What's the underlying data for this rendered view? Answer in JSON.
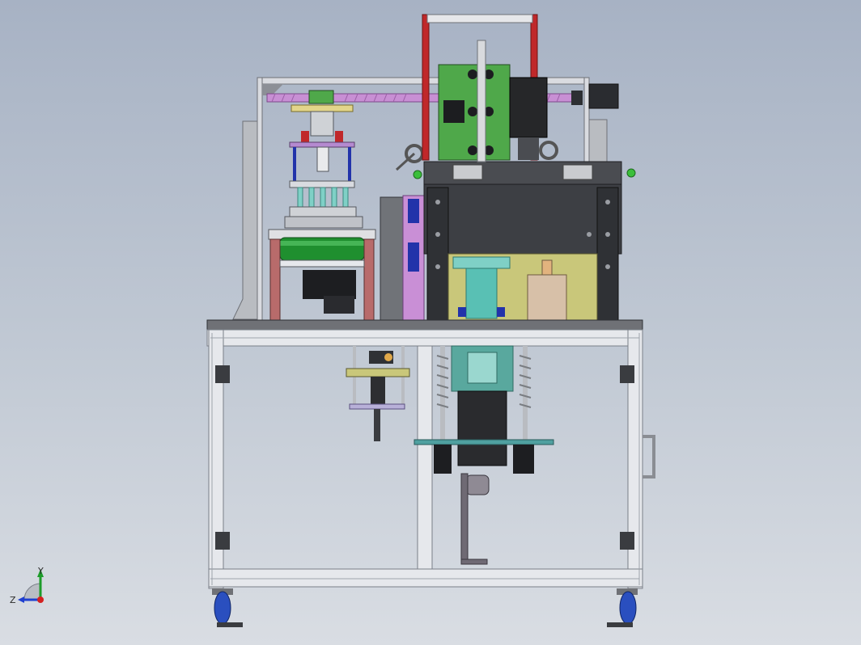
{
  "viewport": {
    "background_top": "#a7b2c4",
    "background_bottom": "#d9dde3"
  },
  "triad": {
    "y_label": "Y",
    "z_label": "Z",
    "x_color": "#d42020",
    "y_color": "#1d9c2a",
    "z_color": "#1f3fd0"
  },
  "colors": {
    "frame": "#e6e8ec",
    "frame_edge": "#7a7f88",
    "dark_body": "#3d3f44",
    "green_board": "#4fa84a",
    "red_rail": "#c0282a",
    "roller_green": "#1f8f2f",
    "teal": "#59c0b4",
    "pink": "#c97fd6",
    "blue": "#2233aa",
    "wheel_blue": "#2a4fbf"
  }
}
